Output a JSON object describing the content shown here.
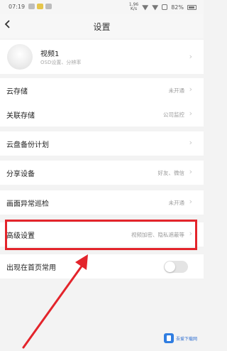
{
  "status_bar": {
    "time": "07:19",
    "network_speed": "1.96\nK/s",
    "battery": "82%"
  },
  "header": {
    "back_icon": "chevron-left",
    "title": "设置"
  },
  "device": {
    "name": "视频1",
    "subtitle": "OSD设置、分辨率"
  },
  "rows": [
    {
      "label": "云存储",
      "value": "未开通"
    },
    {
      "label": "关联存储",
      "value": "公司监控"
    },
    {
      "label": "云盘备份计划",
      "value": ""
    },
    {
      "label": "分享设备",
      "value": "好友、微信"
    },
    {
      "label": "画面异常巡检",
      "value": "未开通"
    },
    {
      "label": "高级设置",
      "value": "视频加密、隐私遮蔽等"
    }
  ],
  "homepage_toggle": {
    "label": "出现在首页常用",
    "on": false
  },
  "annotation": {
    "highlight_color": "#e3242b",
    "arrow_color": "#e3242b"
  },
  "watermark": {
    "text": "吾爱下载网"
  }
}
